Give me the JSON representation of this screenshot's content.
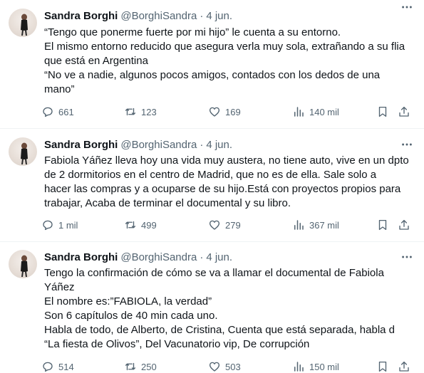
{
  "tweets": [
    {
      "author": "Sandra Borghi",
      "handle": "@BorghiSandra",
      "separator": "·",
      "date": "4 jun.",
      "lines": [
        "“Tengo que ponerme fuerte por mi hijo” le cuenta a su entorno.",
        "El mismo entorno reducido que asegura verla muy sola, extrañando a su flia",
        "que está en Argentina",
        "“No ve a nadie, algunos pocos amigos, contados con los dedos de una",
        "mano”"
      ],
      "replies": "661",
      "retweets": "123",
      "likes": "169",
      "views": "140 mil"
    },
    {
      "author": "Sandra Borghi",
      "handle": "@BorghiSandra",
      "separator": "·",
      "date": "4 jun.",
      "lines": [
        "Fabiola Yáñez lleva hoy una vida muy austera, no tiene auto, vive en un dpto",
        "de 2 dormitorios en el centro de Madrid,  que no es de ella. Sale solo a",
        "hacer las compras y a ocuparse de su hijo.Está con proyectos propios para",
        "trabajar, Acaba de terminar el documental y su libro."
      ],
      "replies": "1 mil",
      "retweets": "499",
      "likes": "279",
      "views": "367 mil"
    },
    {
      "author": "Sandra Borghi",
      "handle": "@BorghiSandra",
      "separator": "·",
      "date": "4 jun.",
      "lines": [
        "Tengo la confirmación de cómo se va a llamar el documental de Fabiola",
        "Yáñez",
        "El nombre es:”FABIOLA, la verdad”",
        "Son 6 capítulos de 40 min cada uno.",
        "Habla de todo, de Alberto, de Cristina, Cuenta que está separada, habla d",
        "“La fiesta de Olivos”, Del Vacunatorio vip, De corrupción"
      ],
      "replies": "514",
      "retweets": "250",
      "likes": "503",
      "views": "150 mil"
    }
  ],
  "icons": {
    "reply": "speech-bubble-icon",
    "retweet": "retweet-arrows-icon",
    "like": "heart-icon",
    "views": "bar-chart-icon",
    "bookmark": "bookmark-icon",
    "share": "share-upload-icon",
    "more": "more-dots-icon"
  },
  "colors": {
    "text": "#0f1419",
    "muted": "#536471",
    "divider": "#eff3f4"
  }
}
